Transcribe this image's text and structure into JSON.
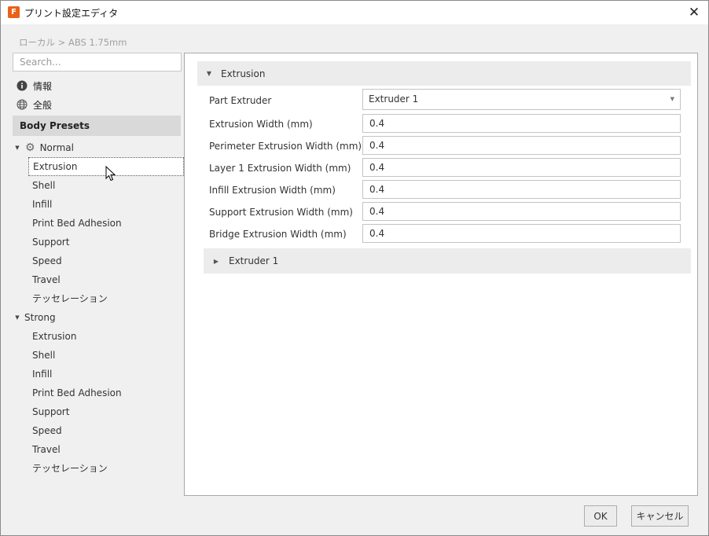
{
  "window": {
    "title": "プリント設定エディタ",
    "app_icon_letter": "F",
    "close_glyph": "✕"
  },
  "breadcrumb": "ローカル > ABS 1.75mm",
  "search": {
    "placeholder": "Search...",
    "value": ""
  },
  "nav": [
    {
      "label": "情報",
      "icon": "info-icon"
    },
    {
      "label": "全般",
      "icon": "globe-icon"
    }
  ],
  "presets_header": "Body Presets",
  "groups": [
    {
      "label": "Normal",
      "icon": "gear-icon",
      "expanded": true,
      "children": [
        "Extrusion",
        "Shell",
        "Infill",
        "Print Bed Adhesion",
        "Support",
        "Speed",
        "Travel",
        "テッセレーション"
      ]
    },
    {
      "label": "Strong",
      "expanded": true,
      "children": [
        "Extrusion",
        "Shell",
        "Infill",
        "Print Bed Adhesion",
        "Support",
        "Speed",
        "Travel",
        "テッセレーション"
      ]
    }
  ],
  "selected": "Normal > Extrusion",
  "section": {
    "title": "Extrusion",
    "part_extruder_label": "Part Extruder",
    "part_extruder_value": "Extruder 1",
    "fields": [
      {
        "label": "Extrusion Width (mm)",
        "value": "0.4"
      },
      {
        "label": "Perimeter Extrusion Width (mm)",
        "value": "0.4"
      },
      {
        "label": "Layer 1 Extrusion Width (mm)",
        "value": "0.4"
      },
      {
        "label": "Infill Extrusion Width (mm)",
        "value": "0.4"
      },
      {
        "label": "Support Extrusion Width (mm)",
        "value": "0.4"
      },
      {
        "label": "Bridge Extrusion Width (mm)",
        "value": "0.4"
      }
    ],
    "subsection": "Extruder 1"
  },
  "buttons": {
    "ok": "OK",
    "cancel": "キャンセル"
  }
}
